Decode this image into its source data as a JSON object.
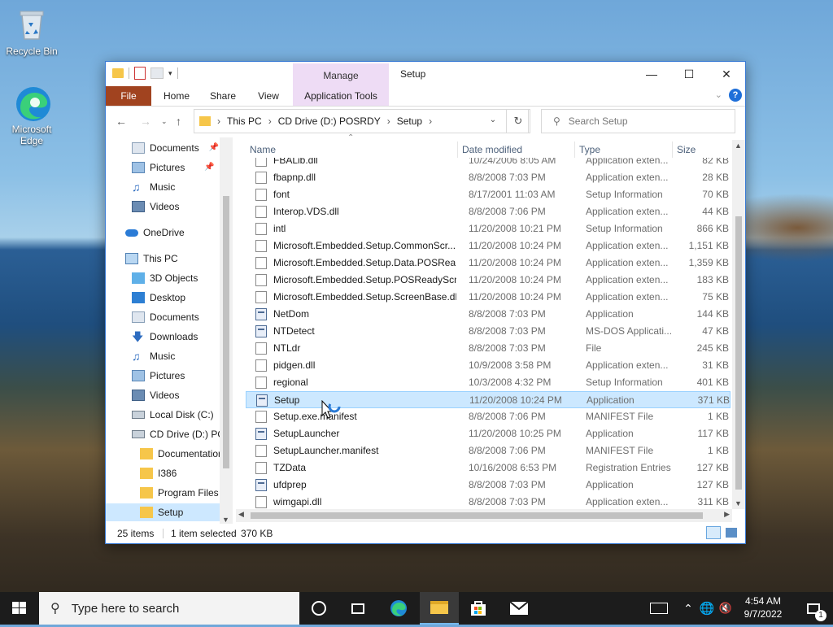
{
  "desktop": {
    "icons": [
      {
        "label": "Recycle Bin"
      },
      {
        "label": "Microsoft Edge"
      }
    ]
  },
  "window": {
    "title": "Setup",
    "context_tab_group": "Manage",
    "ribbon_tabs": [
      "File",
      "Home",
      "Share",
      "View",
      "Application Tools"
    ],
    "breadcrumb": [
      "This PC",
      "CD Drive (D:) POSRDY",
      "Setup"
    ],
    "search_placeholder": "Search Setup"
  },
  "nav_pane": {
    "items": [
      {
        "label": "Documents",
        "icon": "documents-icon",
        "pinned": true
      },
      {
        "label": "Pictures",
        "icon": "pictures-icon",
        "pinned": true
      },
      {
        "label": "Music",
        "icon": "music-icon"
      },
      {
        "label": "Videos",
        "icon": "videos-icon"
      },
      {
        "label": "OneDrive",
        "icon": "onedrive-icon"
      },
      {
        "label": "This PC",
        "icon": "this-pc-icon"
      },
      {
        "label": "3D Objects",
        "icon": "3d-objects-icon"
      },
      {
        "label": "Desktop",
        "icon": "desktop-icon"
      },
      {
        "label": "Documents",
        "icon": "documents-icon"
      },
      {
        "label": "Downloads",
        "icon": "downloads-icon"
      },
      {
        "label": "Music",
        "icon": "music-icon"
      },
      {
        "label": "Pictures",
        "icon": "pictures-icon"
      },
      {
        "label": "Videos",
        "icon": "videos-icon"
      },
      {
        "label": "Local Disk (C:)",
        "icon": "local-disk-icon"
      },
      {
        "label": "CD Drive (D:) PO",
        "icon": "cd-drive-icon"
      },
      {
        "label": "Documentation",
        "icon": "folder-icon"
      },
      {
        "label": "I386",
        "icon": "folder-icon"
      },
      {
        "label": "Program Files",
        "icon": "folder-icon"
      },
      {
        "label": "Setup",
        "icon": "folder-icon",
        "selected": true
      }
    ]
  },
  "columns": {
    "name": "Name",
    "date": "Date modified",
    "type": "Type",
    "size": "Size"
  },
  "files": [
    {
      "name": "FBALib.dll",
      "date": "10/24/2006 8:05 AM",
      "type": "Application exten...",
      "size": "82 KB"
    },
    {
      "name": "fbapnp.dll",
      "date": "8/8/2008 7:03 PM",
      "type": "Application exten...",
      "size": "28 KB"
    },
    {
      "name": "font",
      "date": "8/17/2001 11:03 AM",
      "type": "Setup Information",
      "size": "70 KB"
    },
    {
      "name": "Interop.VDS.dll",
      "date": "8/8/2008 7:06 PM",
      "type": "Application exten...",
      "size": "44 KB"
    },
    {
      "name": "intl",
      "date": "11/20/2008 10:21 PM",
      "type": "Setup Information",
      "size": "866 KB"
    },
    {
      "name": "Microsoft.Embedded.Setup.CommonScr...",
      "date": "11/20/2008 10:24 PM",
      "type": "Application exten...",
      "size": "1,151 KB"
    },
    {
      "name": "Microsoft.Embedded.Setup.Data.POSRea...",
      "date": "11/20/2008 10:24 PM",
      "type": "Application exten...",
      "size": "1,359 KB"
    },
    {
      "name": "Microsoft.Embedded.Setup.POSReadyScr...",
      "date": "11/20/2008 10:24 PM",
      "type": "Application exten...",
      "size": "183 KB"
    },
    {
      "name": "Microsoft.Embedded.Setup.ScreenBase.dll",
      "date": "11/20/2008 10:24 PM",
      "type": "Application exten...",
      "size": "75 KB"
    },
    {
      "name": "NetDom",
      "date": "8/8/2008 7:03 PM",
      "type": "Application",
      "size": "144 KB"
    },
    {
      "name": "NTDetect",
      "date": "8/8/2008 7:03 PM",
      "type": "MS-DOS Applicati...",
      "size": "47 KB"
    },
    {
      "name": "NTLdr",
      "date": "8/8/2008 7:03 PM",
      "type": "File",
      "size": "245 KB"
    },
    {
      "name": "pidgen.dll",
      "date": "10/9/2008 3:58 PM",
      "type": "Application exten...",
      "size": "31 KB"
    },
    {
      "name": "regional",
      "date": "10/3/2008 4:32 PM",
      "type": "Setup Information",
      "size": "401 KB"
    },
    {
      "name": "Setup",
      "date": "11/20/2008 10:24 PM",
      "type": "Application",
      "size": "371 KB",
      "selected": true
    },
    {
      "name": "Setup.exe.manifest",
      "date": "8/8/2008 7:06 PM",
      "type": "MANIFEST File",
      "size": "1 KB"
    },
    {
      "name": "SetupLauncher",
      "date": "11/20/2008 10:25 PM",
      "type": "Application",
      "size": "117 KB"
    },
    {
      "name": "SetupLauncher.manifest",
      "date": "8/8/2008 7:06 PM",
      "type": "MANIFEST File",
      "size": "1 KB"
    },
    {
      "name": "TZData",
      "date": "10/16/2008 6:53 PM",
      "type": "Registration Entries",
      "size": "127 KB"
    },
    {
      "name": "ufdprep",
      "date": "8/8/2008 7:03 PM",
      "type": "Application",
      "size": "127 KB"
    },
    {
      "name": "wimgapi.dll",
      "date": "8/8/2008 7:03 PM",
      "type": "Application exten...",
      "size": "311 KB"
    }
  ],
  "status": {
    "item_count": "25 items",
    "selection": "1 item selected",
    "selection_size": "370 KB"
  },
  "taskbar": {
    "search_placeholder": "Type here to search",
    "time": "4:54 AM",
    "date": "9/7/2022",
    "notification_count": "1"
  },
  "colors": {
    "file_tab": "#a1431f",
    "manage_tab": "#eedcf5",
    "selection": "#cce8ff",
    "accent": "#1e6fd9"
  }
}
